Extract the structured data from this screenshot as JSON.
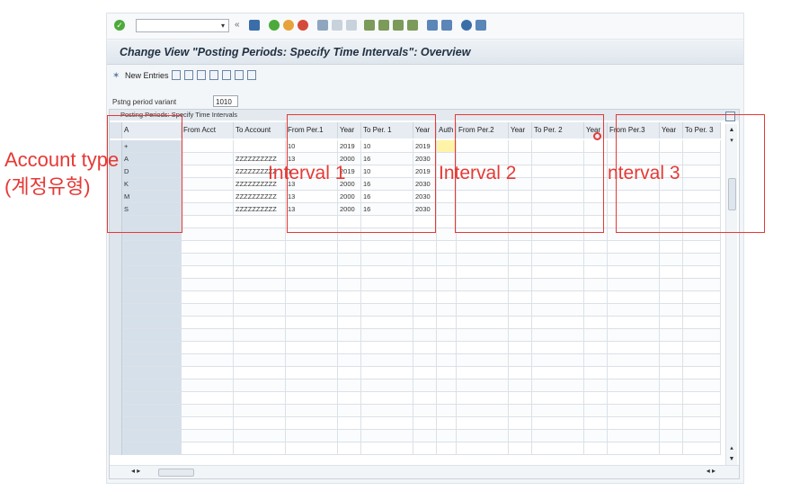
{
  "window": {
    "title": "Change View \"Posting Periods: Specify Time Intervals\": Overview",
    "command_field": ""
  },
  "toolbar": {
    "new_entries_label": "New Entries"
  },
  "variant": {
    "label": "Pstng period variant",
    "value": "1010"
  },
  "table": {
    "caption": "Posting Periods: Specify Time Intervals",
    "headers": [
      "A",
      "From Acct",
      "To Account",
      "From Per.1",
      "Year",
      "To Per. 1",
      "Year",
      "Auth",
      "From Per.2",
      "Year",
      "To Per. 2",
      "Year",
      "From Per.3",
      "Year",
      "To Per. 3"
    ],
    "rows": [
      [
        "+",
        "",
        "",
        "10",
        "2019",
        "10",
        "2019",
        "",
        "",
        "",
        "",
        "",
        "",
        "",
        ""
      ],
      [
        "A",
        "",
        "ZZZZZZZZZZ",
        "13",
        "2000",
        "16",
        "2030",
        "",
        "",
        "",
        "",
        "",
        "",
        "",
        ""
      ],
      [
        "D",
        "",
        "ZZZZZZZZZZ",
        "1",
        "2019",
        "10",
        "2019",
        "",
        "",
        "",
        "",
        "",
        "",
        "",
        ""
      ],
      [
        "K",
        "",
        "ZZZZZZZZZZ",
        "13",
        "2000",
        "16",
        "2030",
        "",
        "",
        "",
        "",
        "",
        "",
        "",
        ""
      ],
      [
        "M",
        "",
        "ZZZZZZZZZZ",
        "13",
        "2000",
        "16",
        "2030",
        "",
        "",
        "",
        "",
        "",
        "",
        "",
        ""
      ],
      [
        "S",
        "",
        "ZZZZZZZZZZ",
        "13",
        "2000",
        "16",
        "2030",
        "",
        "",
        "",
        "",
        "",
        "",
        "",
        ""
      ]
    ]
  },
  "annotations": {
    "account_type": "Account type",
    "account_type_kr": "(계정유형)",
    "interval1": "Interval 1",
    "interval2": "Interval 2",
    "interval3": "nterval 3"
  },
  "colors": {
    "annotation": "#e53935",
    "key_column": "#d6e0ea",
    "title_text": "#223142"
  }
}
